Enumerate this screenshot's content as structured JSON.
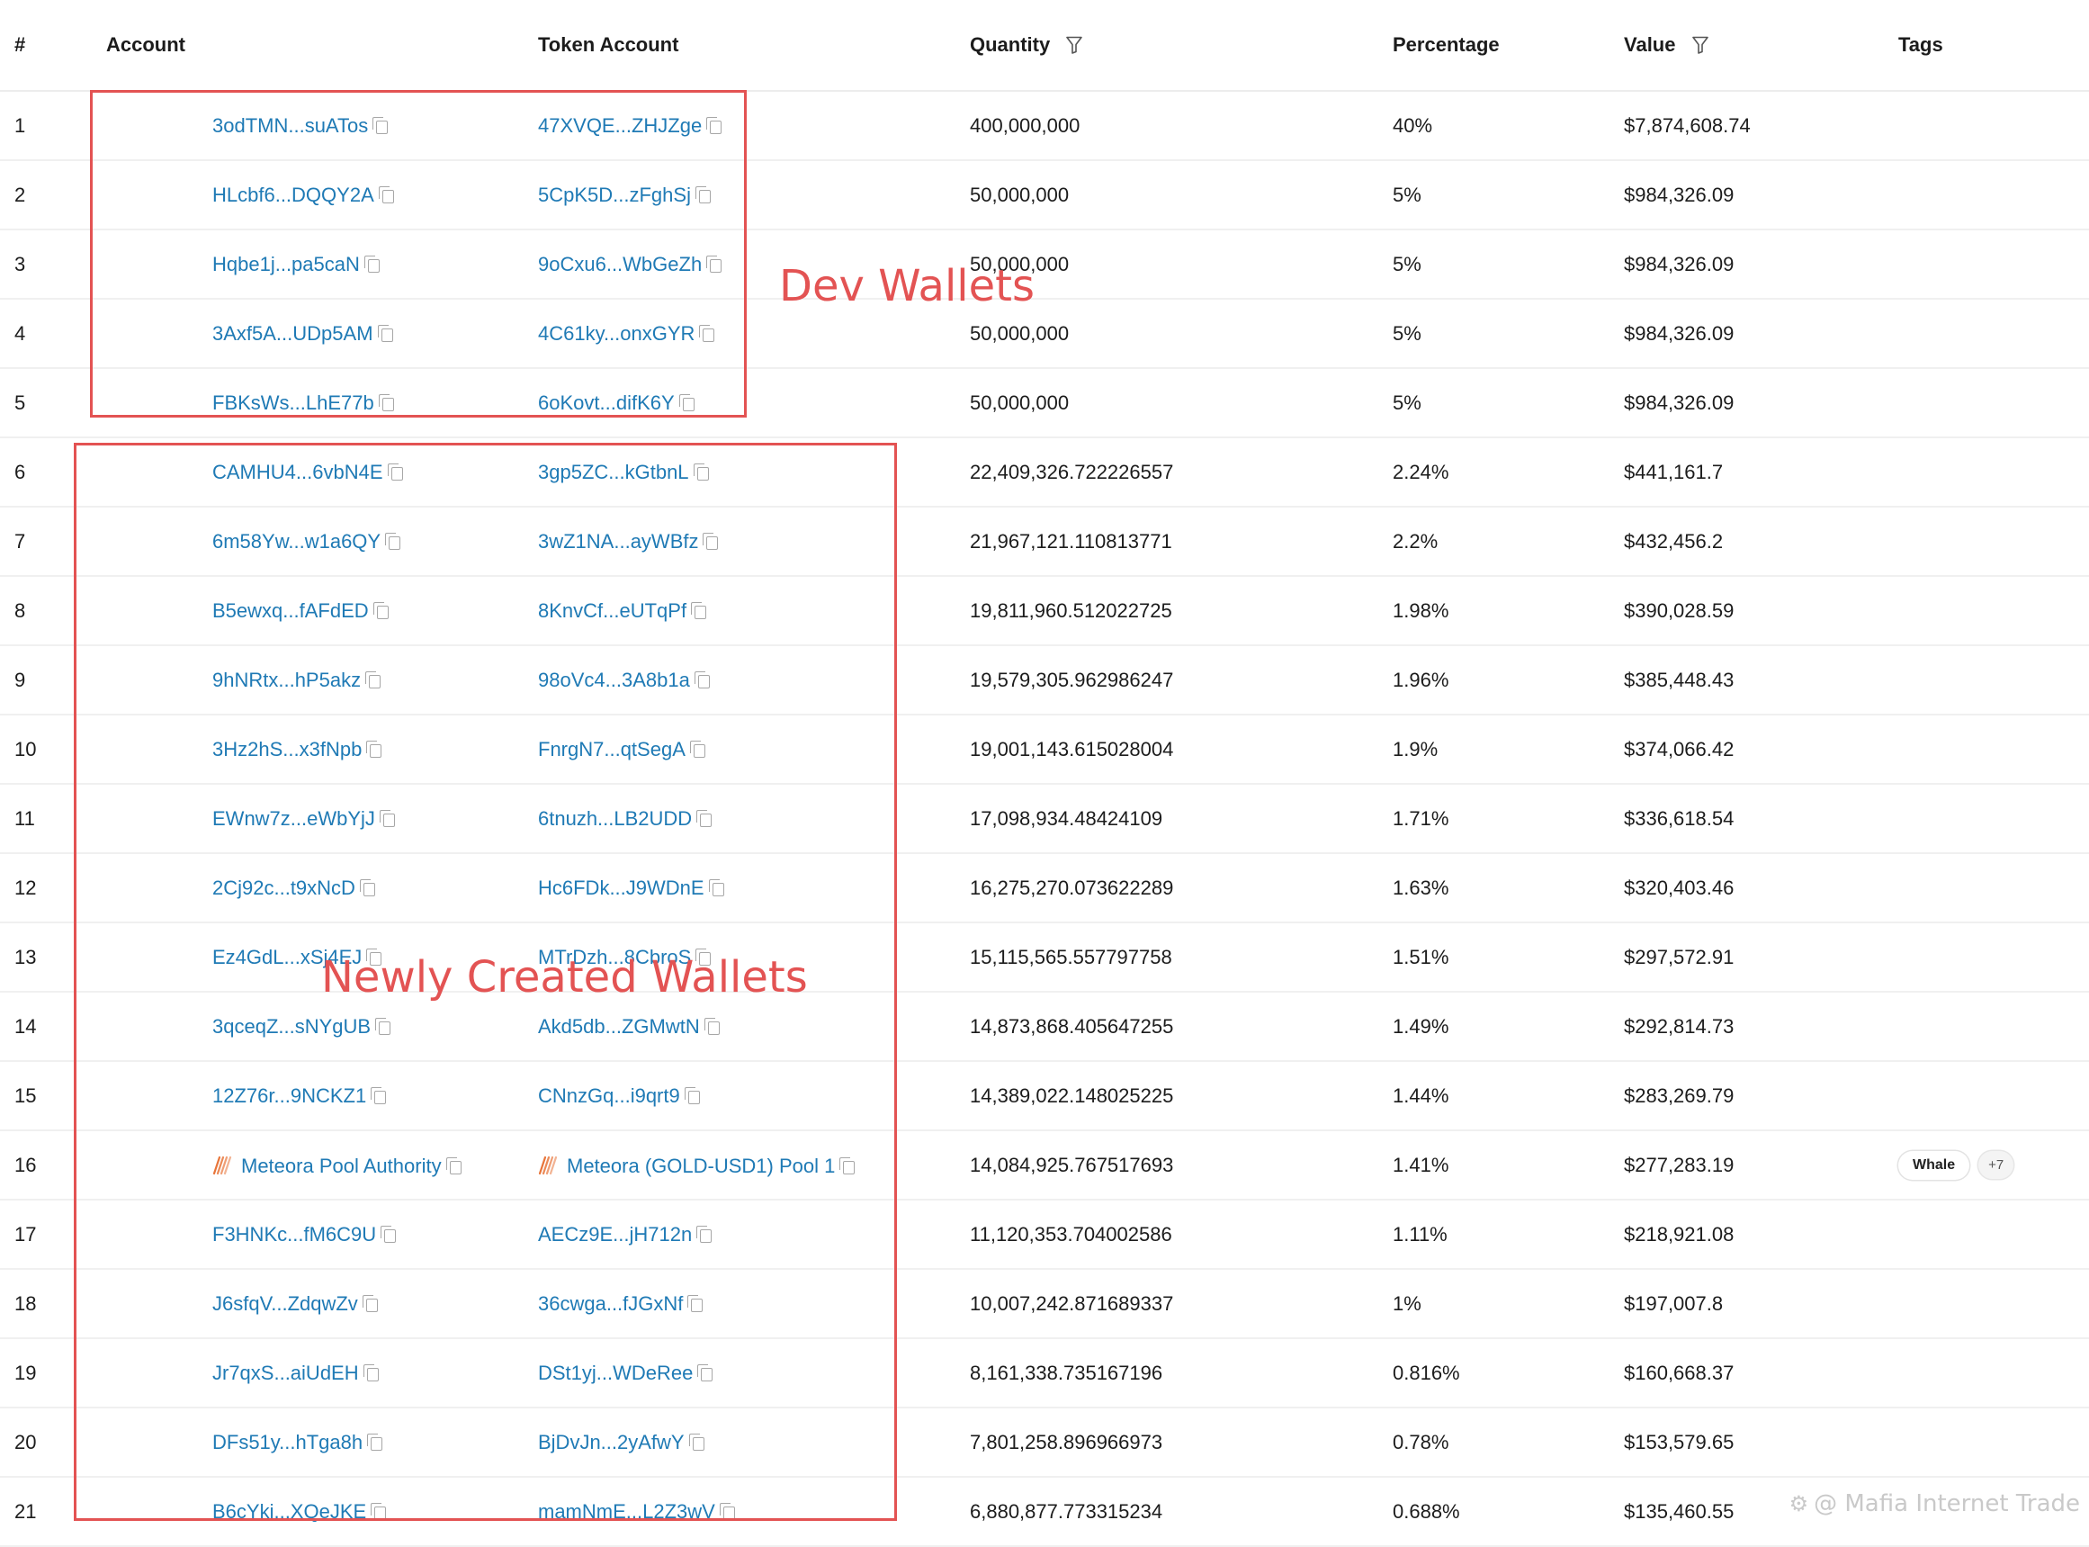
{
  "table": {
    "columns": {
      "num": "#",
      "account": "Account",
      "token_account": "Token Account",
      "quantity": "Quantity",
      "percentage": "Percentage",
      "value": "Value",
      "tags": "Tags"
    },
    "rows": [
      {
        "num": "1",
        "account": "3odTMN...suATos",
        "token": "47XVQE...ZHJZge",
        "quantity": "400,000,000",
        "pct": "40%",
        "value": "$7,874,608.74"
      },
      {
        "num": "2",
        "account": "HLcbf6...DQQY2A",
        "token": "5CpK5D...zFghSj",
        "quantity": "50,000,000",
        "pct": "5%",
        "value": "$984,326.09"
      },
      {
        "num": "3",
        "account": "Hqbe1j...pa5caN",
        "token": "9oCxu6...WbGeZh",
        "quantity": "50,000,000",
        "pct": "5%",
        "value": "$984,326.09"
      },
      {
        "num": "4",
        "account": "3Axf5A...UDp5AM",
        "token": "4C61ky...onxGYR",
        "quantity": "50,000,000",
        "pct": "5%",
        "value": "$984,326.09"
      },
      {
        "num": "5",
        "account": "FBKsWs...LhE77b",
        "token": "6oKovt...difK6Y",
        "quantity": "50,000,000",
        "pct": "5%",
        "value": "$984,326.09"
      },
      {
        "num": "6",
        "account": "CAMHU4...6vbN4E",
        "token": "3gp5ZC...kGtbnL",
        "quantity": "22,409,326.722226557",
        "pct": "2.24%",
        "value": "$441,161.7"
      },
      {
        "num": "7",
        "account": "6m58Yw...w1a6QY",
        "token": "3wZ1NA...ayWBfz",
        "quantity": "21,967,121.110813771",
        "pct": "2.2%",
        "value": "$432,456.2"
      },
      {
        "num": "8",
        "account": "B5ewxq...fAFdED",
        "token": "8KnvCf...eUTqPf",
        "quantity": "19,811,960.512022725",
        "pct": "1.98%",
        "value": "$390,028.59"
      },
      {
        "num": "9",
        "account": "9hNRtx...hP5akz",
        "token": "98oVc4...3A8b1a",
        "quantity": "19,579,305.962986247",
        "pct": "1.96%",
        "value": "$385,448.43"
      },
      {
        "num": "10",
        "account": "3Hz2hS...x3fNpb",
        "token": "FnrgN7...qtSegA",
        "quantity": "19,001,143.615028004",
        "pct": "1.9%",
        "value": "$374,066.42"
      },
      {
        "num": "11",
        "account": "EWnw7z...eWbYjJ",
        "token": "6tnuzh...LB2UDD",
        "quantity": "17,098,934.48424109",
        "pct": "1.71%",
        "value": "$336,618.54"
      },
      {
        "num": "12",
        "account": "2Cj92c...t9xNcD",
        "token": "Hc6FDk...J9WDnE",
        "quantity": "16,275,270.073622289",
        "pct": "1.63%",
        "value": "$320,403.46"
      },
      {
        "num": "13",
        "account": "Ez4GdL...xSj4EJ",
        "token": "MTrDzh...8CbroS",
        "quantity": "15,115,565.557797758",
        "pct": "1.51%",
        "value": "$297,572.91"
      },
      {
        "num": "14",
        "account": "3qceqZ...sNYgUB",
        "token": "Akd5db...ZGMwtN",
        "quantity": "14,873,868.405647255",
        "pct": "1.49%",
        "value": "$292,814.73"
      },
      {
        "num": "15",
        "account": "12Z76r...9NCKZ1",
        "token": "CNnzGq...i9qrt9",
        "quantity": "14,389,022.148025225",
        "pct": "1.44%",
        "value": "$283,269.79"
      },
      {
        "num": "16",
        "account": "Meteora Pool Authority",
        "token": "Meteora (GOLD-USD1) Pool 1",
        "quantity": "14,084,925.767517693",
        "pct": "1.41%",
        "value": "$277,283.19",
        "tag": "Whale",
        "tag_more": "+7"
      },
      {
        "num": "17",
        "account": "F3HNKc...fM6C9U",
        "token": "AECz9E...jH712n",
        "quantity": "11,120,353.704002586",
        "pct": "1.11%",
        "value": "$218,921.08"
      },
      {
        "num": "18",
        "account": "J6sfqV...ZdqwZv",
        "token": "36cwga...fJGxNf",
        "quantity": "10,007,242.871689337",
        "pct": "1%",
        "value": "$197,007.8"
      },
      {
        "num": "19",
        "account": "Jr7qxS...aiUdEH",
        "token": "DSt1yj...WDeRee",
        "quantity": "8,161,338.735167196",
        "pct": "0.816%",
        "value": "$160,668.37"
      },
      {
        "num": "20",
        "account": "DFs51y...hTga8h",
        "token": "BjDvJn...2yAfwY",
        "quantity": "7,801,258.896966973",
        "pct": "0.78%",
        "value": "$153,579.65"
      },
      {
        "num": "21",
        "account": "B6cYki...XQeJKE",
        "token": "mamNmE...L2Z3wV",
        "quantity": "6,880,877.773315234",
        "pct": "0.688%",
        "value": "$135,460.55"
      }
    ]
  },
  "annotations": {
    "dev_label": "Dev Wallets",
    "new_label": "Newly Created Wallets",
    "color": "#e35353"
  },
  "watermark": {
    "text": "@ Mafia Internet Trade",
    "icon": "gear-icon"
  },
  "colors": {
    "link": "#1f7ab5",
    "meteora_orange": "#e8753a"
  }
}
